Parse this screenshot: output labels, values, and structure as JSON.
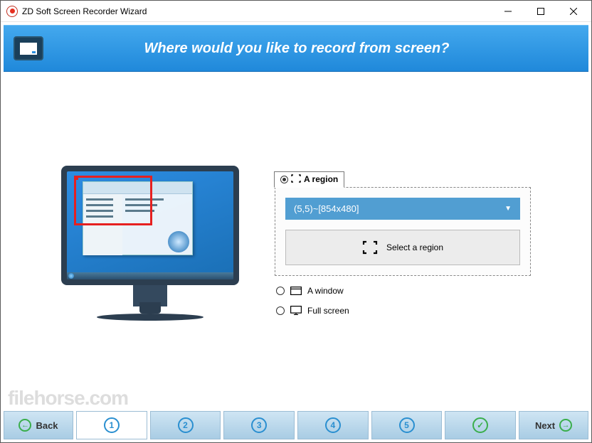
{
  "title": "ZD Soft Screen Recorder Wizard",
  "banner": {
    "heading": "Where would you like to record from screen?"
  },
  "options": {
    "region": {
      "label": "A region",
      "dropdown_value": "(5,5)~[854x480]",
      "select_button": "Select a region"
    },
    "window_label": "A window",
    "fullscreen_label": "Full screen"
  },
  "stepper": {
    "back": "Back",
    "steps": [
      "1",
      "2",
      "3",
      "4",
      "5"
    ],
    "check": "✓",
    "next": "Next"
  },
  "watermark": "filehorse.com"
}
